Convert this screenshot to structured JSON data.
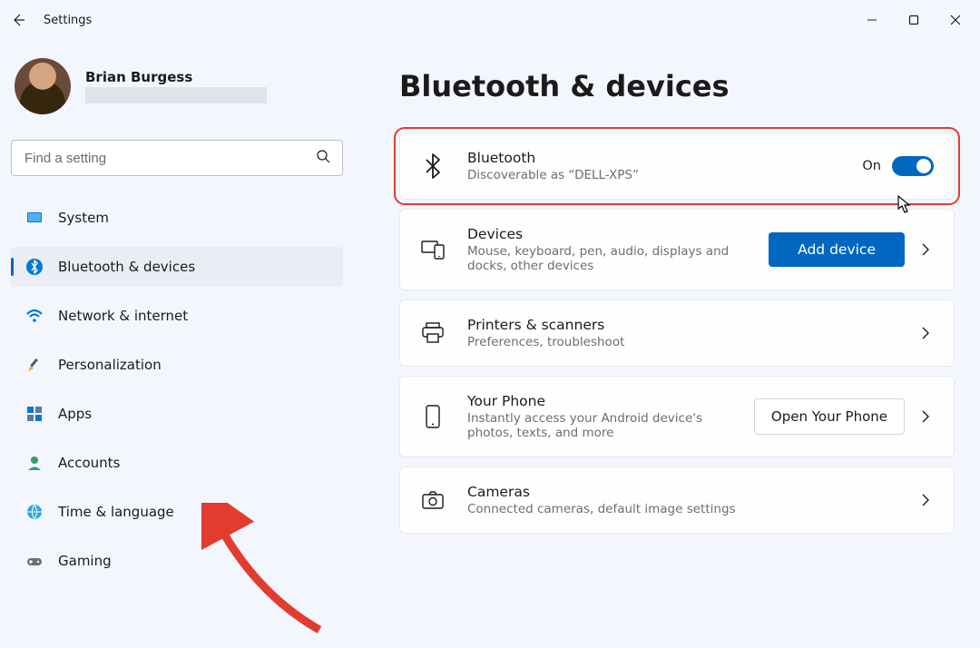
{
  "app": {
    "title": "Settings"
  },
  "profile": {
    "name": "Brian Burgess"
  },
  "search": {
    "placeholder": "Find a setting"
  },
  "nav": {
    "items": [
      {
        "label": "System"
      },
      {
        "label": "Bluetooth & devices"
      },
      {
        "label": "Network & internet"
      },
      {
        "label": "Personalization"
      },
      {
        "label": "Apps"
      },
      {
        "label": "Accounts"
      },
      {
        "label": "Time & language"
      },
      {
        "label": "Gaming"
      }
    ]
  },
  "page": {
    "title": "Bluetooth & devices"
  },
  "bluetoothCard": {
    "title": "Bluetooth",
    "sub": "Discoverable as “DELL-XPS”",
    "state": "On"
  },
  "devicesCard": {
    "title": "Devices",
    "sub": "Mouse, keyboard, pen, audio, displays and docks, other devices",
    "button": "Add device"
  },
  "printersCard": {
    "title": "Printers & scanners",
    "sub": "Preferences, troubleshoot"
  },
  "phoneCard": {
    "title": "Your Phone",
    "sub": "Instantly access your Android device's photos, texts, and more",
    "button": "Open Your Phone"
  },
  "camerasCard": {
    "title": "Cameras",
    "sub": "Connected cameras, default image settings"
  }
}
